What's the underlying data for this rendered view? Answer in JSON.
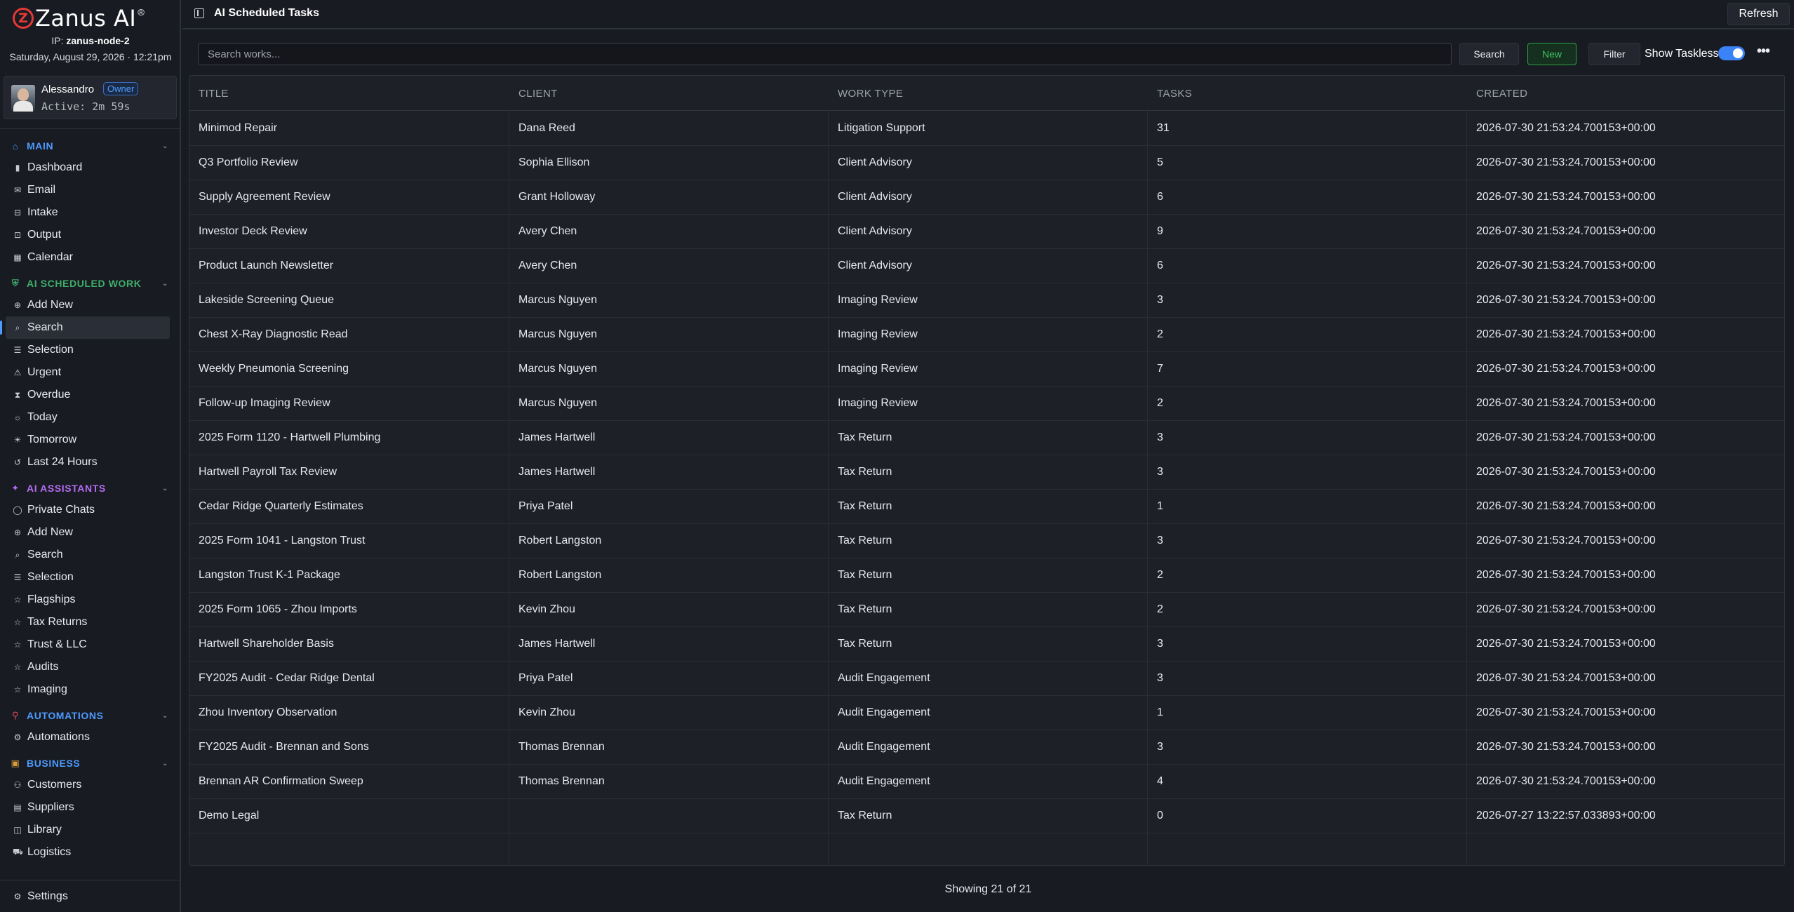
{
  "brand": {
    "logo_letter": "Z",
    "name": "Zanus AI",
    "reg": "®"
  },
  "node": {
    "label": "IP:",
    "value": "zanus-node-2"
  },
  "datetime": "Saturday, August 29, 2026 · 12:21pm",
  "user": {
    "name": "Alessandro",
    "role": "Owner",
    "active": "Active: 2m 59s"
  },
  "sidebar": {
    "sections": [
      {
        "title": "MAIN",
        "icon": "home-icon",
        "color": "#4d9bff",
        "items": [
          {
            "label": "Dashboard",
            "icon": "bar-chart-icon"
          },
          {
            "label": "Email",
            "icon": "mail-icon"
          },
          {
            "label": "Intake",
            "icon": "inbox-icon"
          },
          {
            "label": "Output",
            "icon": "output-icon"
          },
          {
            "label": "Calendar",
            "icon": "calendar-icon"
          }
        ]
      },
      {
        "title": "AI SCHEDULED WORK",
        "icon": "shield-icon",
        "color": "#3fae6a",
        "items": [
          {
            "label": "Add New",
            "icon": "plus-circle-icon"
          },
          {
            "label": "Search",
            "icon": "search-icon",
            "active": true
          },
          {
            "label": "Selection",
            "icon": "list-icon"
          },
          {
            "label": "Urgent",
            "icon": "warning-icon"
          },
          {
            "label": "Overdue",
            "icon": "hourglass-icon"
          },
          {
            "label": "Today",
            "icon": "sun-icon"
          },
          {
            "label": "Tomorrow",
            "icon": "sunrise-icon"
          },
          {
            "label": "Last 24 Hours",
            "icon": "history-icon"
          }
        ]
      },
      {
        "title": "AI ASSISTANTS",
        "icon": "sparkle-icon",
        "color": "#b46cf0",
        "items": [
          {
            "label": "Private Chats",
            "icon": "chat-icon"
          },
          {
            "label": "Add New",
            "icon": "plus-circle-icon"
          },
          {
            "label": "Search",
            "icon": "search-icon"
          },
          {
            "label": "Selection",
            "icon": "list-icon"
          },
          {
            "label": "Flagships",
            "icon": "star-icon"
          },
          {
            "label": "Tax Returns",
            "icon": "star-icon"
          },
          {
            "label": "Trust & LLC",
            "icon": "star-icon"
          },
          {
            "label": "Audits",
            "icon": "star-icon"
          },
          {
            "label": "Imaging",
            "icon": "star-icon"
          }
        ]
      },
      {
        "title": "AUTOMATIONS",
        "icon": "plug-icon",
        "color": "#e5475c",
        "items": [
          {
            "label": "Automations",
            "icon": "network-icon"
          }
        ]
      },
      {
        "title": "BUSINESS",
        "icon": "briefcase-icon",
        "color": "#d89a3a",
        "items": [
          {
            "label": "Customers",
            "icon": "users-icon"
          },
          {
            "label": "Suppliers",
            "icon": "building-icon"
          },
          {
            "label": "Library",
            "icon": "book-icon"
          },
          {
            "label": "Logistics",
            "icon": "truck-icon"
          }
        ]
      }
    ],
    "settings_label": "Settings"
  },
  "header": {
    "title": "AI Scheduled Tasks",
    "refresh_label": "Refresh"
  },
  "toolbar": {
    "search_placeholder": "Search works...",
    "search_label": "Search",
    "new_label": "New",
    "filter_label": "Filter",
    "taskless_label": "Show Taskless",
    "taskless_on": true
  },
  "table": {
    "columns": [
      "TITLE",
      "CLIENT",
      "WORK TYPE",
      "TASKS",
      "CREATED"
    ],
    "rows": [
      [
        "Minimod Repair",
        "Dana Reed",
        "Litigation Support",
        "31",
        "2026-07-30 21:53:24.700153+00:00"
      ],
      [
        "Q3 Portfolio Review",
        "Sophia Ellison",
        "Client Advisory",
        "5",
        "2026-07-30 21:53:24.700153+00:00"
      ],
      [
        "Supply Agreement Review",
        "Grant Holloway",
        "Client Advisory",
        "6",
        "2026-07-30 21:53:24.700153+00:00"
      ],
      [
        "Investor Deck Review",
        "Avery Chen",
        "Client Advisory",
        "9",
        "2026-07-30 21:53:24.700153+00:00"
      ],
      [
        "Product Launch Newsletter",
        "Avery Chen",
        "Client Advisory",
        "6",
        "2026-07-30 21:53:24.700153+00:00"
      ],
      [
        "Lakeside Screening Queue",
        "Marcus Nguyen",
        "Imaging Review",
        "3",
        "2026-07-30 21:53:24.700153+00:00"
      ],
      [
        "Chest X-Ray Diagnostic Read",
        "Marcus Nguyen",
        "Imaging Review",
        "2",
        "2026-07-30 21:53:24.700153+00:00"
      ],
      [
        "Weekly Pneumonia Screening",
        "Marcus Nguyen",
        "Imaging Review",
        "7",
        "2026-07-30 21:53:24.700153+00:00"
      ],
      [
        "Follow-up Imaging Review",
        "Marcus Nguyen",
        "Imaging Review",
        "2",
        "2026-07-30 21:53:24.700153+00:00"
      ],
      [
        "2025 Form 1120 - Hartwell Plumbing",
        "James Hartwell",
        "Tax Return",
        "3",
        "2026-07-30 21:53:24.700153+00:00"
      ],
      [
        "Hartwell Payroll Tax Review",
        "James Hartwell",
        "Tax Return",
        "3",
        "2026-07-30 21:53:24.700153+00:00"
      ],
      [
        "Cedar Ridge Quarterly Estimates",
        "Priya Patel",
        "Tax Return",
        "1",
        "2026-07-30 21:53:24.700153+00:00"
      ],
      [
        "2025 Form 1041 - Langston Trust",
        "Robert Langston",
        "Tax Return",
        "3",
        "2026-07-30 21:53:24.700153+00:00"
      ],
      [
        "Langston Trust K-1 Package",
        "Robert Langston",
        "Tax Return",
        "2",
        "2026-07-30 21:53:24.700153+00:00"
      ],
      [
        "2025 Form 1065 - Zhou Imports",
        "Kevin Zhou",
        "Tax Return",
        "2",
        "2026-07-30 21:53:24.700153+00:00"
      ],
      [
        "Hartwell Shareholder Basis",
        "James Hartwell",
        "Tax Return",
        "3",
        "2026-07-30 21:53:24.700153+00:00"
      ],
      [
        "FY2025 Audit - Cedar Ridge Dental",
        "Priya Patel",
        "Audit Engagement",
        "3",
        "2026-07-30 21:53:24.700153+00:00"
      ],
      [
        "Zhou Inventory Observation",
        "Kevin Zhou",
        "Audit Engagement",
        "1",
        "2026-07-30 21:53:24.700153+00:00"
      ],
      [
        "FY2025 Audit - Brennan and Sons",
        "Thomas Brennan",
        "Audit Engagement",
        "3",
        "2026-07-30 21:53:24.700153+00:00"
      ],
      [
        "Brennan AR Confirmation Sweep",
        "Thomas Brennan",
        "Audit Engagement",
        "4",
        "2026-07-30 21:53:24.700153+00:00"
      ],
      [
        "Demo Legal",
        "",
        "Tax Return",
        "0",
        "2026-07-27 13:22:57.033893+00:00"
      ]
    ]
  },
  "footer": {
    "count_text": "Showing 21 of 21"
  }
}
